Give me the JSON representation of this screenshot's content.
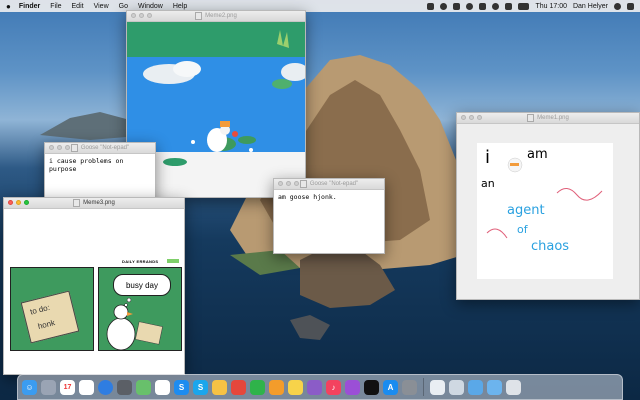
{
  "menubar": {
    "app_name": "Finder",
    "items": [
      "File",
      "Edit",
      "View",
      "Go",
      "Window",
      "Help"
    ],
    "clock": "Thu 17:00",
    "user": "Dan Helyer"
  },
  "windows": {
    "meme2": {
      "title": "Meme2.png"
    },
    "meme1": {
      "title": "Meme1.png"
    },
    "meme3": {
      "title": "Meme3.png",
      "strip_header": "DAILY ERRANDS",
      "todo_label": "to do:",
      "todo_item": "honk",
      "bubble": "busy day"
    },
    "note1": {
      "title": "Goose \"Not-epad\"",
      "text": "i cause problems on purpose"
    },
    "note2": {
      "title": "Goose \"Not-epad\"",
      "text": "am goose hjonk."
    }
  },
  "meme1_words": {
    "line1": "i",
    "line2": "am",
    "line3": "an",
    "line4": "agent",
    "line5": "of",
    "line6": "chaos"
  },
  "colors": {
    "pond_green": "#2e9c6b",
    "water_blue": "#2f8fe6",
    "comic_green": "#3e9a5e",
    "chaos_blue": "#2aa1e0"
  },
  "dock": {
    "icons": [
      "finder-icon",
      "launchpad-icon",
      "calendar-icon",
      "reminders-icon",
      "safari-icon",
      "screenshot-icon",
      "maps-icon",
      "slack-icon",
      "shazam-icon",
      "skype-icon",
      "photos-icon",
      "screen-time-icon",
      "numbers-icon",
      "pages-icon",
      "notes-icon",
      "affinity-icon",
      "music-icon",
      "podcasts-icon",
      "tv-icon",
      "app-store-icon",
      "system-preferences-icon",
      "preview-icon",
      "documents-icon",
      "downloads-icon",
      "folder-icon",
      "trash-icon"
    ]
  }
}
